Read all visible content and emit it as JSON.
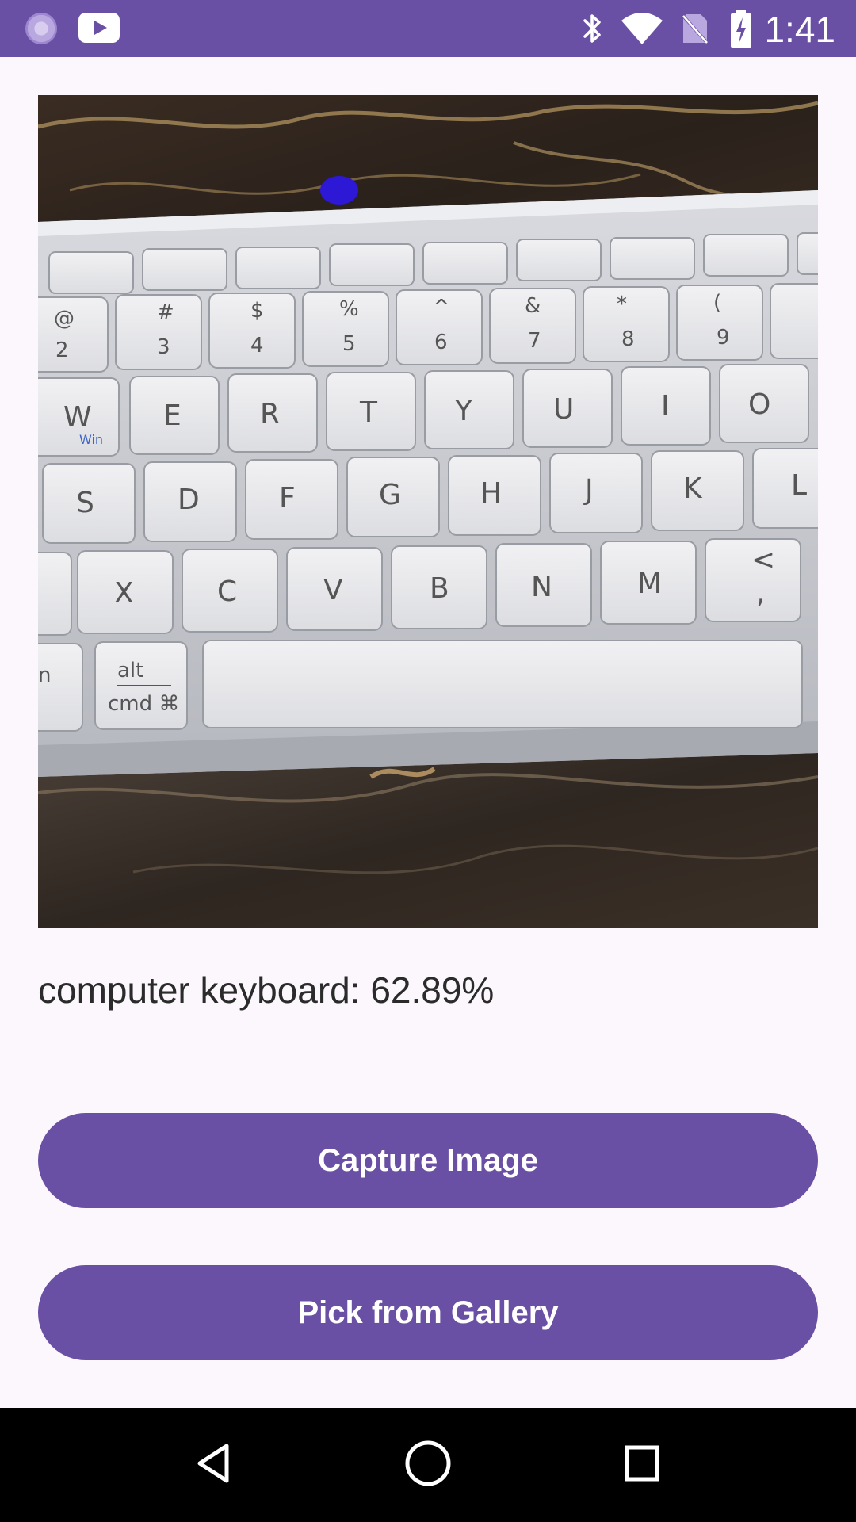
{
  "status_bar": {
    "time": "1:41",
    "icons": [
      "app-circle-icon",
      "youtube-icon",
      "bluetooth-icon",
      "wifi-icon",
      "no-sim-icon",
      "battery-charging-icon"
    ]
  },
  "photo": {
    "description_icon": "keyboard-photo"
  },
  "result": {
    "label": "computer keyboard: 62.89%"
  },
  "buttons": {
    "capture_label": "Capture Image",
    "gallery_label": "Pick from Gallery"
  },
  "nav": {
    "icons": [
      "back-icon",
      "home-icon",
      "recents-icon"
    ]
  },
  "colors": {
    "primary": "#6A50A4",
    "background": "#FCF7FC",
    "nav": "#000000"
  }
}
